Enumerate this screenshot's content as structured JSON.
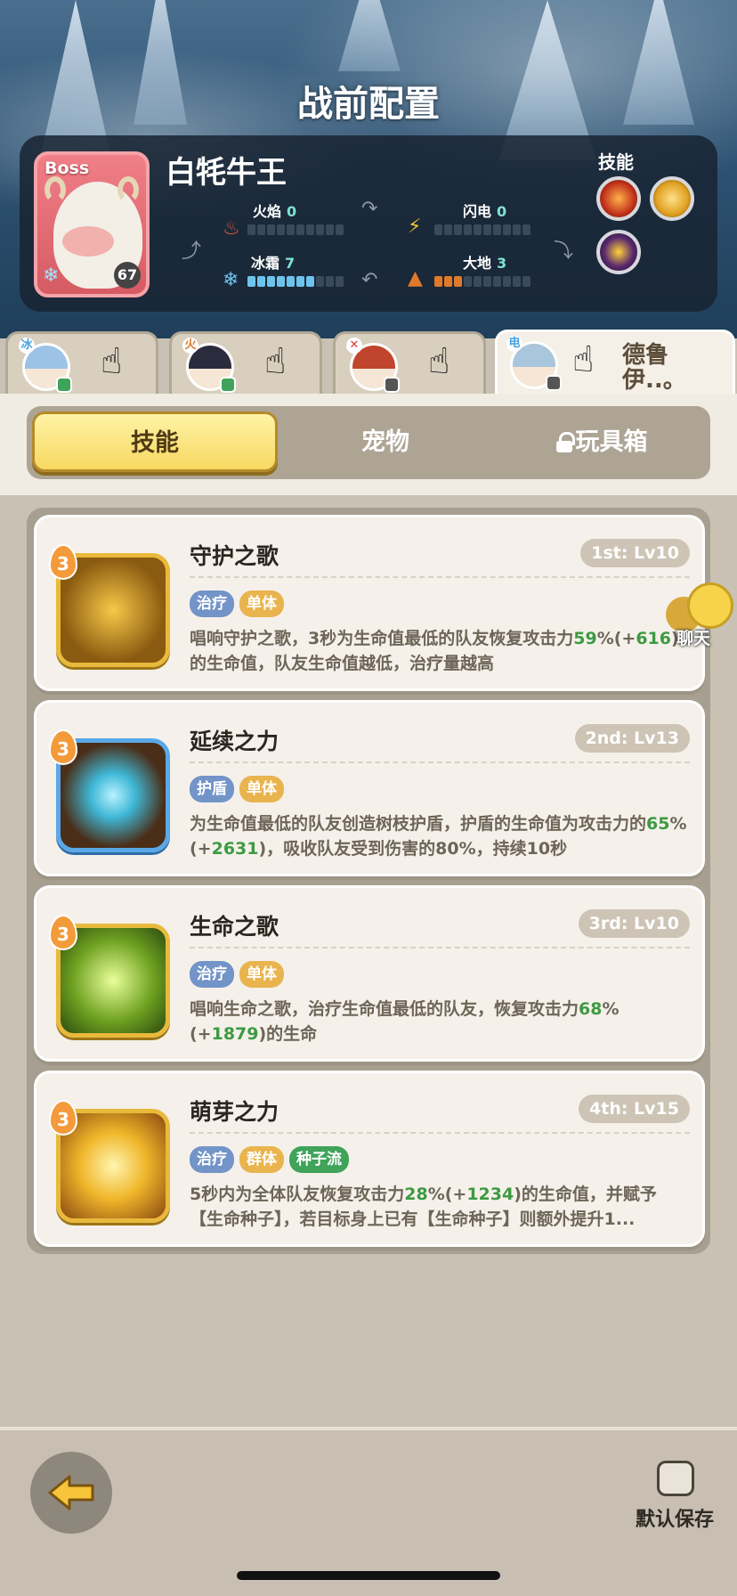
{
  "header": {
    "title": "战前配置"
  },
  "boss": {
    "tag": "Boss",
    "name": "白牦牛王",
    "level": "67",
    "skills_label": "技能",
    "stats": [
      {
        "name": "火焰",
        "value": "0",
        "filled": 0,
        "color": "#e0553a"
      },
      {
        "name": "闪电",
        "value": "0",
        "filled": 0,
        "color": "#f2c030"
      },
      {
        "name": "冰霜",
        "value": "7",
        "filled": 7,
        "color": "#6ec3ec"
      },
      {
        "name": "大地",
        "value": "3",
        "filled": 3,
        "color": "#e07a2a"
      }
    ]
  },
  "team": [
    {
      "element": "冰"
    },
    {
      "element": "火"
    },
    {
      "element": "✕"
    },
    {
      "element": "电",
      "name": "德鲁伊..。"
    }
  ],
  "tabs": {
    "skills": "技能",
    "pets": "宠物",
    "toybox": "玩具箱"
  },
  "skills": [
    {
      "rank": "3",
      "title": "守护之歌",
      "level": "1st: Lv10",
      "tags": [
        "治疗",
        "单体"
      ],
      "desc_a": "唱响守护之歌，3秒为生命值最低的队友恢复攻击力",
      "desc_g1": "59",
      "desc_b": "%(+",
      "desc_g2": "616",
      "desc_c": ")的生命值，队友生命值越低，治疗量越高"
    },
    {
      "rank": "3",
      "title": "延续之力",
      "level": "2nd: Lv13",
      "tags": [
        "护盾",
        "单体"
      ],
      "desc_a": "为生命值最低的队友创造树枝护盾，护盾的生命值为攻击力的",
      "desc_g1": "65",
      "desc_b": "%(+",
      "desc_g2": "2631",
      "desc_c": ")，吸收队友受到伤害的80%，持续10秒"
    },
    {
      "rank": "3",
      "title": "生命之歌",
      "level": "3rd: Lv10",
      "tags": [
        "治疗",
        "单体"
      ],
      "desc_a": "唱响生命之歌，治疗生命值最低的队友，恢复攻击力",
      "desc_g1": "68",
      "desc_b": "%(+",
      "desc_g2": "1879",
      "desc_c": ")的生命"
    },
    {
      "rank": "3",
      "title": "萌芽之力",
      "level": "4th: Lv15",
      "tags": [
        "治疗",
        "群体",
        "种子流"
      ],
      "desc_a": "5秒内为全体队友恢复攻击力",
      "desc_g1": "28",
      "desc_b": "%(+",
      "desc_g2": "1234",
      "desc_c": ")的生命值，并赋予【生命种子】，若目标身上已有【生命种子】则额外提升1..."
    }
  ],
  "chat": {
    "label": "聊天"
  },
  "footer": {
    "save_label": "默认保存"
  }
}
